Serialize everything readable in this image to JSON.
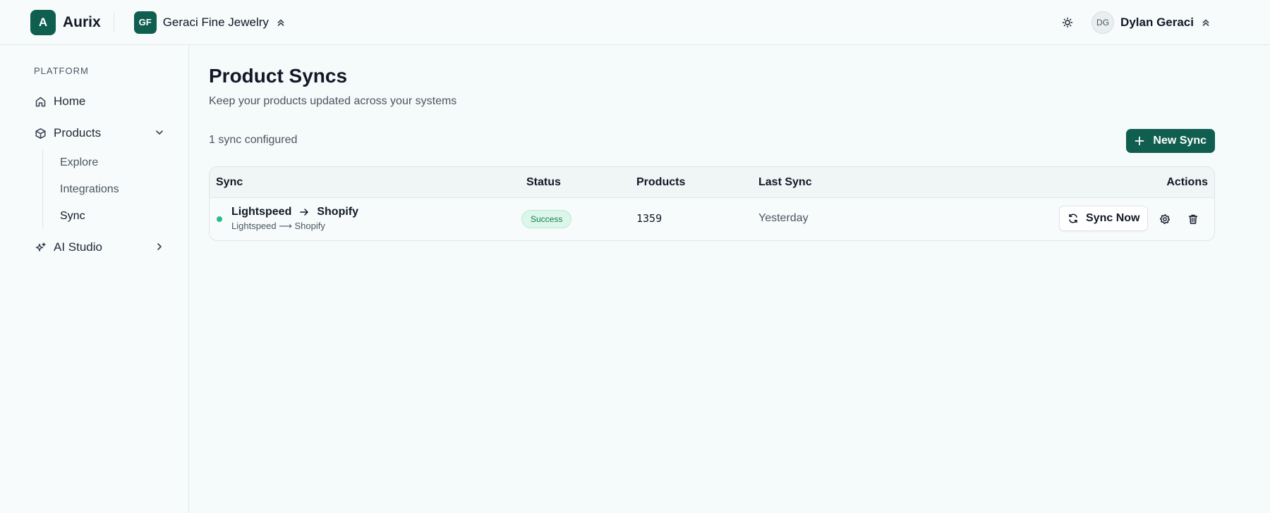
{
  "app": {
    "logo_letter": "A",
    "name": "Aurix",
    "brand_color": "#0f5e4f"
  },
  "org": {
    "initials": "GF",
    "name": "Geraci Fine Jewelry"
  },
  "user": {
    "initials": "DG",
    "name": "Dylan Geraci"
  },
  "sidebar": {
    "section_label": "PLATFORM",
    "items": [
      {
        "label": "Home",
        "icon": "home-icon"
      },
      {
        "label": "Products",
        "icon": "box-icon",
        "expanded": true,
        "children": [
          {
            "label": "Explore"
          },
          {
            "label": "Integrations"
          },
          {
            "label": "Sync",
            "active": true
          }
        ]
      },
      {
        "label": "AI Studio",
        "icon": "sparkles-icon",
        "expanded": false
      }
    ]
  },
  "main": {
    "title": "Product Syncs",
    "subtitle": "Keep your products updated across your systems",
    "count_text": "1 sync configured",
    "new_button": "New Sync",
    "table": {
      "headers": [
        "Sync",
        "Status",
        "Products",
        "Last Sync",
        "Actions"
      ],
      "rows": [
        {
          "source": "Lightspeed",
          "target": "Shopify",
          "route": "Lightspeed ⟶ Shopify",
          "status": "Success",
          "products": "1359",
          "last_sync": "Yesterday",
          "action_label": "Sync Now"
        }
      ]
    }
  },
  "colors": {
    "success_dot": "#22c08a",
    "success_badge_bg": "#dcf7e9",
    "success_badge_text": "#16794f"
  }
}
